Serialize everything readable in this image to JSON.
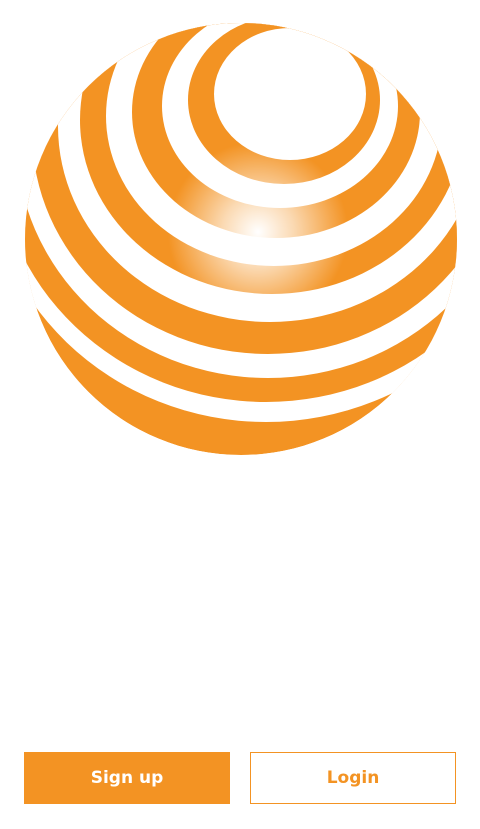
{
  "colors": {
    "brand_orange": "#f39323",
    "background": "#ffffff",
    "button_text_primary": "#ffffff"
  },
  "logo": {
    "icon": "striped-globe-icon"
  },
  "actions": {
    "signup_label": "Sign up",
    "login_label": "Login"
  }
}
